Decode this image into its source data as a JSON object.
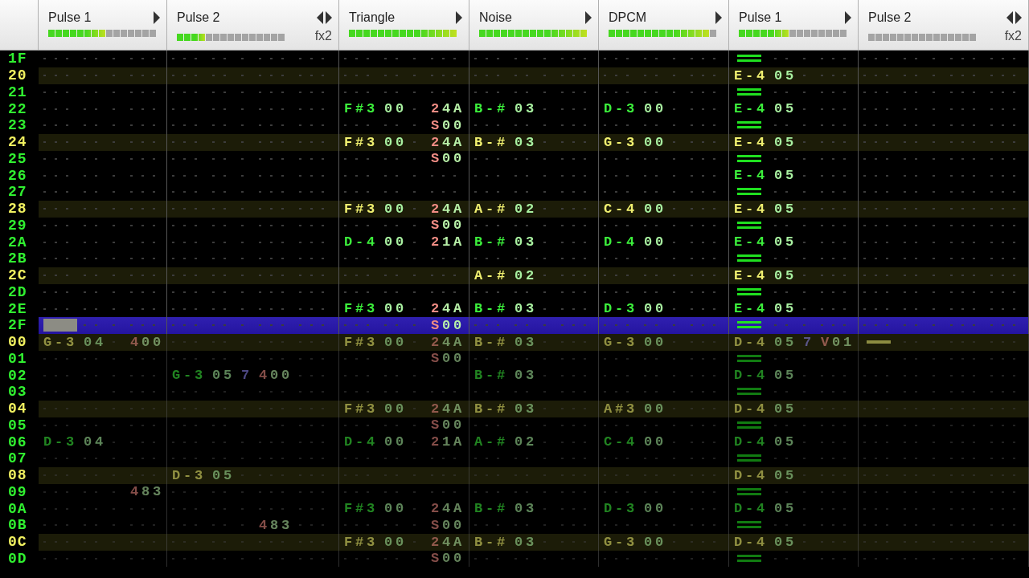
{
  "channels": [
    {
      "name": "Pulse 1",
      "can_shrink": false,
      "can_expand": true,
      "meter": {
        "level": 0.53
      }
    },
    {
      "name": "Pulse 2",
      "can_shrink": true,
      "can_expand": true,
      "fx_label": "fx2",
      "meter": {
        "level": 0.27
      }
    },
    {
      "name": "Triangle",
      "can_shrink": false,
      "can_expand": true,
      "meter": {
        "level": 1
      }
    },
    {
      "name": "Noise",
      "can_shrink": false,
      "can_expand": true,
      "meter": {
        "level": 1
      }
    },
    {
      "name": "DPCM",
      "can_shrink": false,
      "can_expand": true,
      "meter": {
        "level": 0.93
      }
    },
    {
      "name": "Pulse 1",
      "can_shrink": false,
      "can_expand": true,
      "meter": {
        "level": 0.47
      }
    },
    {
      "name": "Pulse 2",
      "can_shrink": true,
      "can_expand": true,
      "fx_label": "fx2",
      "meter": {
        "level": 0
      }
    }
  ],
  "rows": [
    {
      "number": "1F",
      "highlight": false,
      "cursor": false,
      "preview": false,
      "cells": [
        {},
        {},
        {},
        {},
        {},
        {
          "release": true
        },
        {}
      ]
    },
    {
      "number": "20",
      "highlight": true,
      "cursor": false,
      "preview": false,
      "cells": [
        {},
        {},
        {},
        {},
        {},
        {
          "note": "E-4",
          "inst": "05"
        },
        {}
      ]
    },
    {
      "number": "21",
      "highlight": false,
      "cursor": false,
      "preview": false,
      "cells": [
        {},
        {},
        {},
        {},
        {},
        {
          "release": true
        },
        {}
      ]
    },
    {
      "number": "22",
      "highlight": false,
      "cursor": false,
      "preview": false,
      "cells": [
        {},
        {},
        {
          "note": "F#3",
          "inst": "00",
          "fx": [
            "24A"
          ]
        },
        {
          "note": "B-#",
          "inst": "03"
        },
        {
          "note": "D-3",
          "inst": "00"
        },
        {
          "note": "E-4",
          "inst": "05"
        },
        {}
      ]
    },
    {
      "number": "23",
      "highlight": false,
      "cursor": false,
      "preview": false,
      "cells": [
        {},
        {},
        {
          "fx": [
            "S00"
          ]
        },
        {},
        {},
        {
          "release": true
        },
        {}
      ]
    },
    {
      "number": "24",
      "highlight": true,
      "cursor": false,
      "preview": false,
      "cells": [
        {},
        {},
        {
          "note": "F#3",
          "inst": "00",
          "fx": [
            "24A"
          ]
        },
        {
          "note": "B-#",
          "inst": "03"
        },
        {
          "note": "G-3",
          "inst": "00"
        },
        {
          "note": "E-4",
          "inst": "05"
        },
        {}
      ]
    },
    {
      "number": "25",
      "highlight": false,
      "cursor": false,
      "preview": false,
      "cells": [
        {},
        {},
        {
          "fx": [
            "S00"
          ]
        },
        {},
        {},
        {
          "release": true
        },
        {}
      ]
    },
    {
      "number": "26",
      "highlight": false,
      "cursor": false,
      "preview": false,
      "cells": [
        {},
        {},
        {},
        {},
        {},
        {
          "note": "E-4",
          "inst": "05"
        },
        {}
      ]
    },
    {
      "number": "27",
      "highlight": false,
      "cursor": false,
      "preview": false,
      "cells": [
        {},
        {},
        {},
        {},
        {},
        {
          "release": true
        },
        {}
      ]
    },
    {
      "number": "28",
      "highlight": true,
      "cursor": false,
      "preview": false,
      "cells": [
        {},
        {},
        {
          "note": "F#3",
          "inst": "00",
          "fx": [
            "24A"
          ]
        },
        {
          "note": "A-#",
          "inst": "02"
        },
        {
          "note": "C-4",
          "inst": "00"
        },
        {
          "note": "E-4",
          "inst": "05"
        },
        {}
      ]
    },
    {
      "number": "29",
      "highlight": false,
      "cursor": false,
      "preview": false,
      "cells": [
        {},
        {},
        {
          "fx": [
            "S00"
          ]
        },
        {},
        {},
        {
          "release": true
        },
        {}
      ]
    },
    {
      "number": "2A",
      "highlight": false,
      "cursor": false,
      "preview": false,
      "cells": [
        {},
        {},
        {
          "note": "D-4",
          "inst": "00",
          "fx": [
            "21A"
          ]
        },
        {
          "note": "B-#",
          "inst": "03"
        },
        {
          "note": "D-4",
          "inst": "00"
        },
        {
          "note": "E-4",
          "inst": "05"
        },
        {}
      ]
    },
    {
      "number": "2B",
      "highlight": false,
      "cursor": false,
      "preview": false,
      "cells": [
        {},
        {},
        {},
        {},
        {},
        {
          "release": true
        },
        {}
      ]
    },
    {
      "number": "2C",
      "highlight": true,
      "cursor": false,
      "preview": false,
      "cells": [
        {},
        {},
        {},
        {
          "note": "A-#",
          "inst": "02"
        },
        {},
        {
          "note": "E-4",
          "inst": "05"
        },
        {}
      ]
    },
    {
      "number": "2D",
      "highlight": false,
      "cursor": false,
      "preview": false,
      "cells": [
        {},
        {},
        {},
        {},
        {},
        {
          "release": true
        },
        {}
      ]
    },
    {
      "number": "2E",
      "highlight": false,
      "cursor": false,
      "preview": false,
      "cells": [
        {},
        {},
        {
          "note": "F#3",
          "inst": "00",
          "fx": [
            "24A"
          ]
        },
        {
          "note": "B-#",
          "inst": "03"
        },
        {
          "note": "D-3",
          "inst": "00"
        },
        {
          "note": "E-4",
          "inst": "05"
        },
        {}
      ]
    },
    {
      "number": "2F",
      "highlight": false,
      "cursor": true,
      "preview": false,
      "cells": [
        {
          "cursor": true
        },
        {},
        {
          "fx": [
            "S00"
          ]
        },
        {},
        {},
        {
          "release": true
        },
        {}
      ]
    },
    {
      "number": "00",
      "highlight": true,
      "cursor": false,
      "preview": true,
      "cells": [
        {
          "note": "G-3",
          "inst": "04",
          "fx": [
            "400"
          ]
        },
        {},
        {
          "note": "F#3",
          "inst": "00",
          "fx": [
            "24A"
          ]
        },
        {
          "note": "B-#",
          "inst": "03"
        },
        {
          "note": "G-3",
          "inst": "00"
        },
        {
          "note": "D-4",
          "inst": "05",
          "vol": "7",
          "fx": [
            "V01"
          ]
        },
        {
          "cut": true
        }
      ]
    },
    {
      "number": "01",
      "highlight": false,
      "cursor": false,
      "preview": true,
      "cells": [
        {},
        {},
        {
          "fx": [
            "S00"
          ]
        },
        {},
        {},
        {
          "release": true
        },
        {}
      ]
    },
    {
      "number": "02",
      "highlight": false,
      "cursor": false,
      "preview": true,
      "cells": [
        {},
        {
          "note": "G-3",
          "inst": "05",
          "vol": "7",
          "fx": [
            "400"
          ]
        },
        {},
        {
          "note": "B-#",
          "inst": "03"
        },
        {},
        {
          "note": "D-4",
          "inst": "05"
        },
        {}
      ]
    },
    {
      "number": "03",
      "highlight": false,
      "cursor": false,
      "preview": true,
      "cells": [
        {},
        {},
        {},
        {},
        {},
        {
          "release": true
        },
        {}
      ]
    },
    {
      "number": "04",
      "highlight": true,
      "cursor": false,
      "preview": true,
      "cells": [
        {},
        {},
        {
          "note": "F#3",
          "inst": "00",
          "fx": [
            "24A"
          ]
        },
        {
          "note": "B-#",
          "inst": "03"
        },
        {
          "note": "A#3",
          "inst": "00"
        },
        {
          "note": "D-4",
          "inst": "05"
        },
        {}
      ]
    },
    {
      "number": "05",
      "highlight": false,
      "cursor": false,
      "preview": true,
      "cells": [
        {},
        {},
        {
          "fx": [
            "S00"
          ]
        },
        {},
        {},
        {
          "release": true
        },
        {}
      ]
    },
    {
      "number": "06",
      "highlight": false,
      "cursor": false,
      "preview": true,
      "cells": [
        {
          "note": "D-3",
          "inst": "04"
        },
        {},
        {
          "note": "D-4",
          "inst": "00",
          "fx": [
            "21A"
          ]
        },
        {
          "note": "A-#",
          "inst": "02"
        },
        {
          "note": "C-4",
          "inst": "00"
        },
        {
          "note": "D-4",
          "inst": "05"
        },
        {}
      ]
    },
    {
      "number": "07",
      "highlight": false,
      "cursor": false,
      "preview": true,
      "cells": [
        {},
        {},
        {},
        {},
        {},
        {
          "release": true
        },
        {}
      ]
    },
    {
      "number": "08",
      "highlight": true,
      "cursor": false,
      "preview": true,
      "cells": [
        {},
        {
          "note": "D-3",
          "inst": "05"
        },
        {},
        {},
        {},
        {
          "note": "D-4",
          "inst": "05"
        },
        {}
      ]
    },
    {
      "number": "09",
      "highlight": false,
      "cursor": false,
      "preview": true,
      "cells": [
        {
          "fx": [
            "483"
          ]
        },
        {},
        {},
        {},
        {},
        {
          "release": true
        },
        {}
      ]
    },
    {
      "number": "0A",
      "highlight": false,
      "cursor": false,
      "preview": true,
      "cells": [
        {},
        {},
        {
          "note": "F#3",
          "inst": "00",
          "fx": [
            "24A"
          ]
        },
        {
          "note": "B-#",
          "inst": "03"
        },
        {
          "note": "D-3",
          "inst": "00"
        },
        {
          "note": "D-4",
          "inst": "05"
        },
        {}
      ]
    },
    {
      "number": "0B",
      "highlight": false,
      "cursor": false,
      "preview": true,
      "cells": [
        {},
        {
          "fx": [
            "483"
          ]
        },
        {
          "fx": [
            "S00"
          ]
        },
        {},
        {},
        {
          "release": true
        },
        {}
      ]
    },
    {
      "number": "0C",
      "highlight": true,
      "cursor": false,
      "preview": true,
      "cells": [
        {},
        {},
        {
          "note": "F#3",
          "inst": "00",
          "fx": [
            "24A"
          ]
        },
        {
          "note": "B-#",
          "inst": "03"
        },
        {
          "note": "G-3",
          "inst": "00"
        },
        {
          "note": "D-4",
          "inst": "05"
        },
        {}
      ]
    },
    {
      "number": "0D",
      "highlight": false,
      "cursor": false,
      "preview": true,
      "cells": [
        {},
        {},
        {
          "fx": [
            "S00"
          ]
        },
        {},
        {},
        {
          "release": true
        },
        {}
      ]
    }
  ]
}
